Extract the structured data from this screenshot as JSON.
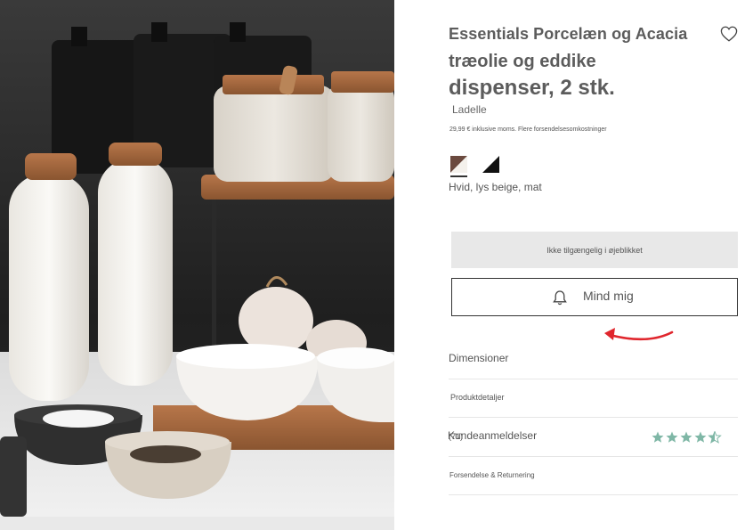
{
  "product": {
    "title_line1": "Essentials Porcelæn og Acacia",
    "title_line2": "træolie og eddike",
    "title_line3": "dispenser, 2 stk.",
    "brand": "Ladelle",
    "price_note": "29,99 € inklusive moms. Flere forsendelsesomkostninger"
  },
  "color": {
    "selected_label": "Hvid, lys beige, mat",
    "swatches": [
      {
        "name": "brown-white",
        "colors": [
          "#6b4a3f",
          "#f4f1ec"
        ]
      },
      {
        "name": "black-white",
        "colors": [
          "#111111",
          "#ffffff"
        ]
      }
    ]
  },
  "actions": {
    "unavailable_label": "Ikke tilgængelig i øjeblikket",
    "remind_label": "Mind mig"
  },
  "accordion": {
    "dimensions": "Dimensioner",
    "product_details": "Produktdetaljer",
    "reviews": "Kundeanmeldelser",
    "review_count": "(71)",
    "rating": 4.5,
    "shipping": "Forsendelse & Returnering"
  },
  "theme": {
    "star_color": "#7fb7a6",
    "arrow_color": "#e0262d"
  },
  "icons": [
    "heart-icon",
    "bell-icon",
    "star-icon",
    "red-arrow-icon"
  ]
}
